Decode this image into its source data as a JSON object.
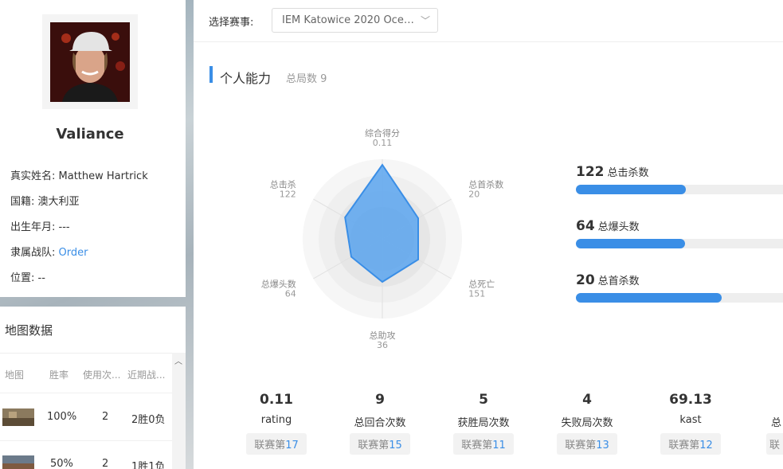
{
  "player": {
    "name": "Valiance",
    "real_name_label": "真实姓名:",
    "real_name": "Matthew Hartrick",
    "nationality_label": "国籍:",
    "nationality": "澳大利亚",
    "birth_label": "出生年月:",
    "birth": "---",
    "team_label": "隶属战队:",
    "team": "Order",
    "position_label": "位置:",
    "position": "--"
  },
  "maps": {
    "title": "地图数据",
    "headers": [
      "地图",
      "胜率",
      "使用次...",
      "近期战..."
    ],
    "rows": [
      {
        "winrate": "100%",
        "uses": "2",
        "recent": "2胜0负"
      },
      {
        "winrate": "50%",
        "uses": "2",
        "recent": "1胜1负"
      }
    ]
  },
  "topbar": {
    "label": "选择赛事:",
    "selected": "IEM Katowice 2020 Oceania..."
  },
  "section": {
    "title": "个人能力",
    "sub_label": "总局数",
    "sub_value": "9"
  },
  "radar": {
    "axes": [
      {
        "label": "综合得分",
        "value": "0.11"
      },
      {
        "label": "总首杀数",
        "value": "20"
      },
      {
        "label": "总死亡",
        "value": "151"
      },
      {
        "label": "总助攻",
        "value": "36"
      },
      {
        "label": "总爆头数",
        "value": "64"
      },
      {
        "label": "总击杀",
        "value": "122"
      }
    ],
    "levels": [
      0.93,
      0.52,
      0.52,
      0.54,
      0.45,
      0.54
    ]
  },
  "bars": [
    {
      "value": "122",
      "label": "总击杀数",
      "fill": 0.53
    },
    {
      "value": "64",
      "label": "总爆头数",
      "fill": 0.525
    },
    {
      "value": "20",
      "label": "总首杀数",
      "fill": 0.705
    }
  ],
  "metrics": [
    {
      "value": "0.11",
      "label": "rating",
      "rank_prefix": "联赛第",
      "rank": "17"
    },
    {
      "value": "9",
      "label": "总回合次数",
      "rank_prefix": "联赛第",
      "rank": "15"
    },
    {
      "value": "5",
      "label": "获胜局次数",
      "rank_prefix": "联赛第",
      "rank": "11"
    },
    {
      "value": "4",
      "label": "失败局次数",
      "rank_prefix": "联赛第",
      "rank": "13"
    },
    {
      "value": "69.13",
      "label": "kast",
      "rank_prefix": "联赛第",
      "rank": "12"
    },
    {
      "value": "",
      "label": "总",
      "rank_prefix": "联",
      "rank": ""
    }
  ],
  "colors": {
    "accent": "#3a8ee6",
    "radar_fill": "#5aa5ee"
  }
}
